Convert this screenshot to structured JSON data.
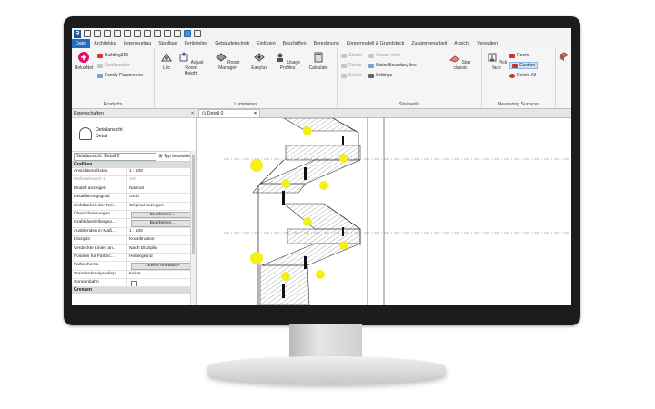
{
  "app": {
    "logo_letter": "R"
  },
  "ribbon_tabs": [
    "Datei",
    "Architektur",
    "Ingenieurbau",
    "Stahlbau",
    "Fertigteilen",
    "Gebäudetechnik",
    "Einfügen",
    "Beschriften",
    "Berechnung",
    "Körpermodell & Grundstück",
    "Zusammenarbeit",
    "Ansicht",
    "Verwalten"
  ],
  "ribbon": {
    "products": {
      "title": "Products",
      "reluxnet": "ReluxNet",
      "building360": "Building360",
      "configurator": "Configurator",
      "family_parameters": "Family Parameters"
    },
    "luminaires": {
      "title": "Luminaires",
      "ldc": "Ldc",
      "adjust_room_height": "Adjust Room Height",
      "room_manager": "Room Manager",
      "easylux": "Easylux",
      "usage_profiles": "Usage Profiles",
      "calculate": "Calculate"
    },
    "stairwells": {
      "title": "Stairwells",
      "create": "Create",
      "delete": "Delete",
      "select": "Select",
      "create_view": "Create View",
      "stairs_boundary_line": "Stairs Boundary line",
      "settings": "Settings",
      "stair_classic": "Stair classic"
    },
    "measuring": {
      "title": "Measuring Surfaces",
      "pick_face": "Pick face",
      "room": "Room",
      "custom": "Custom",
      "delete_all": "Delete All"
    }
  },
  "properties": {
    "header": "Eigenschaften",
    "type_name": "Detailansicht",
    "type_sub": "Detail",
    "selector": "Detailansicht: Detail 0",
    "edit_type": "Typ bearbeiten",
    "group_graphics": "Grafiken",
    "rows": [
      {
        "key": "Ansichtsmaßstab",
        "value": "1 : 100",
        "kind": "field"
      },
      {
        "key": "Maßstabswert 1:",
        "value": "100",
        "kind": "dim"
      },
      {
        "key": "Modell anzeigen",
        "value": "Normal",
        "kind": "text"
      },
      {
        "key": "Detaillierungsgrad",
        "value": "Grob",
        "kind": "text"
      },
      {
        "key": "Sichtbarkeit der Teil...",
        "value": "Original anzeigen",
        "kind": "text"
      },
      {
        "key": "Überschreibungen ...",
        "value": "Bearbeiten...",
        "kind": "button"
      },
      {
        "key": "Grafikdarstellungso...",
        "value": "Bearbeiten...",
        "kind": "button"
      },
      {
        "key": "Ausblenden in Maß...",
        "value": "1 : 100",
        "kind": "text"
      },
      {
        "key": "Disziplin",
        "value": "Koordination",
        "kind": "text"
      },
      {
        "key": "Verdeckte Linien an...",
        "value": "Nach Disziplin",
        "kind": "text"
      },
      {
        "key": "Position für Farbsc...",
        "value": "Hintergrund",
        "kind": "text"
      },
      {
        "key": "Farbschema",
        "value": "<Keine Auswahl>",
        "kind": "button"
      },
      {
        "key": "Standardanalysedisp...",
        "value": "Keine",
        "kind": "text"
      },
      {
        "key": "Sonnenbahn",
        "value": "",
        "kind": "check"
      }
    ],
    "group_bounds": "Grenzen"
  },
  "view_tab": {
    "title": "Detail 0",
    "close": "×"
  },
  "colors": {
    "accent": "#1f6fc5",
    "luminaire": "#f4f017"
  }
}
